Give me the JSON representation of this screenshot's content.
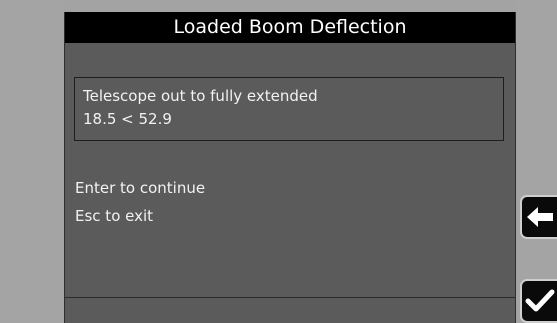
{
  "dialog": {
    "title": "Loaded Boom Deflection",
    "message_line_1": "Telescope out to fully extended",
    "message_line_2": "18.5 < 52.9",
    "instruction_continue": "Enter to continue",
    "instruction_exit": "Esc to exit"
  },
  "buttons": {
    "back_icon": "left-arrow-icon",
    "enter_icon": "checkmark-icon"
  },
  "colors": {
    "title_bar": "#000000",
    "panel": "#5b5b5b",
    "side_bezel": "#a4a4a4",
    "text": "#f2f2f2"
  }
}
